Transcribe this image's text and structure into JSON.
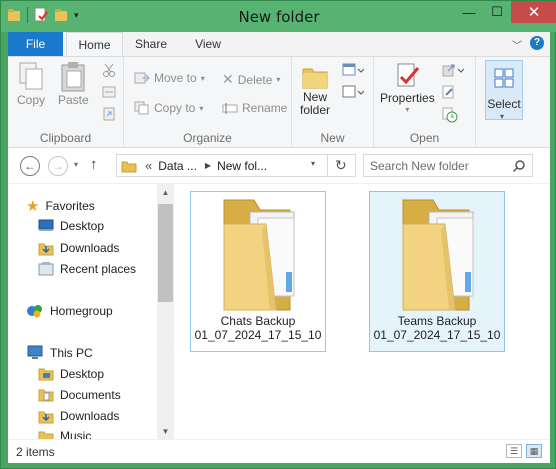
{
  "window": {
    "title": "New folder"
  },
  "tabs": {
    "file": "File",
    "home": "Home",
    "share": "Share",
    "view": "View"
  },
  "ribbon": {
    "clipboard": {
      "label": "Clipboard",
      "copy": "Copy",
      "paste": "Paste"
    },
    "organize": {
      "label": "Organize",
      "move_to": "Move to",
      "copy_to": "Copy to",
      "delete": "Delete",
      "rename": "Rename"
    },
    "new": {
      "label": "New",
      "new_folder_line1": "New",
      "new_folder_line2": "folder"
    },
    "open": {
      "label": "Open",
      "properties": "Properties"
    },
    "select": {
      "label": "Select"
    }
  },
  "address": {
    "prefix": "«",
    "crumb1": "Data ...",
    "crumb2": "New fol...",
    "search_placeholder": "Search New folder"
  },
  "nav": {
    "favorites": "Favorites",
    "desktop": "Desktop",
    "downloads": "Downloads",
    "recent": "Recent places",
    "homegroup": "Homegroup",
    "thispc": "This PC",
    "pc_desktop": "Desktop",
    "pc_documents": "Documents",
    "pc_downloads": "Downloads",
    "pc_music": "Music"
  },
  "items": [
    {
      "name_line1": "Chats Backup",
      "name_line2": "01_07_2024_17_15_10"
    },
    {
      "name_line1": "Teams Backup",
      "name_line2": "01_07_2024_17_15_10"
    }
  ],
  "status": {
    "count": "2 items"
  },
  "colors": {
    "titlebar": "#56b372",
    "file_tab": "#1979ca",
    "close": "#c74b48",
    "selection": "#e5f3fb"
  }
}
